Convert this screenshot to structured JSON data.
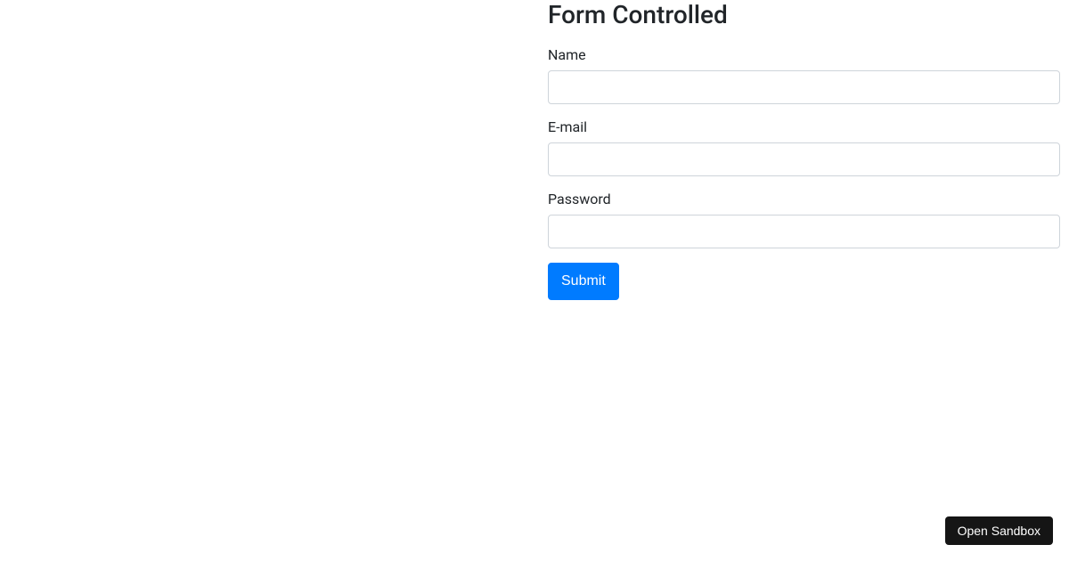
{
  "form": {
    "title": "Form Controlled",
    "fields": {
      "name": {
        "label": "Name",
        "value": ""
      },
      "email": {
        "label": "E-mail",
        "value": ""
      },
      "password": {
        "label": "Password",
        "value": ""
      }
    },
    "submit_label": "Submit"
  },
  "sandbox": {
    "button_label": "Open Sandbox"
  }
}
